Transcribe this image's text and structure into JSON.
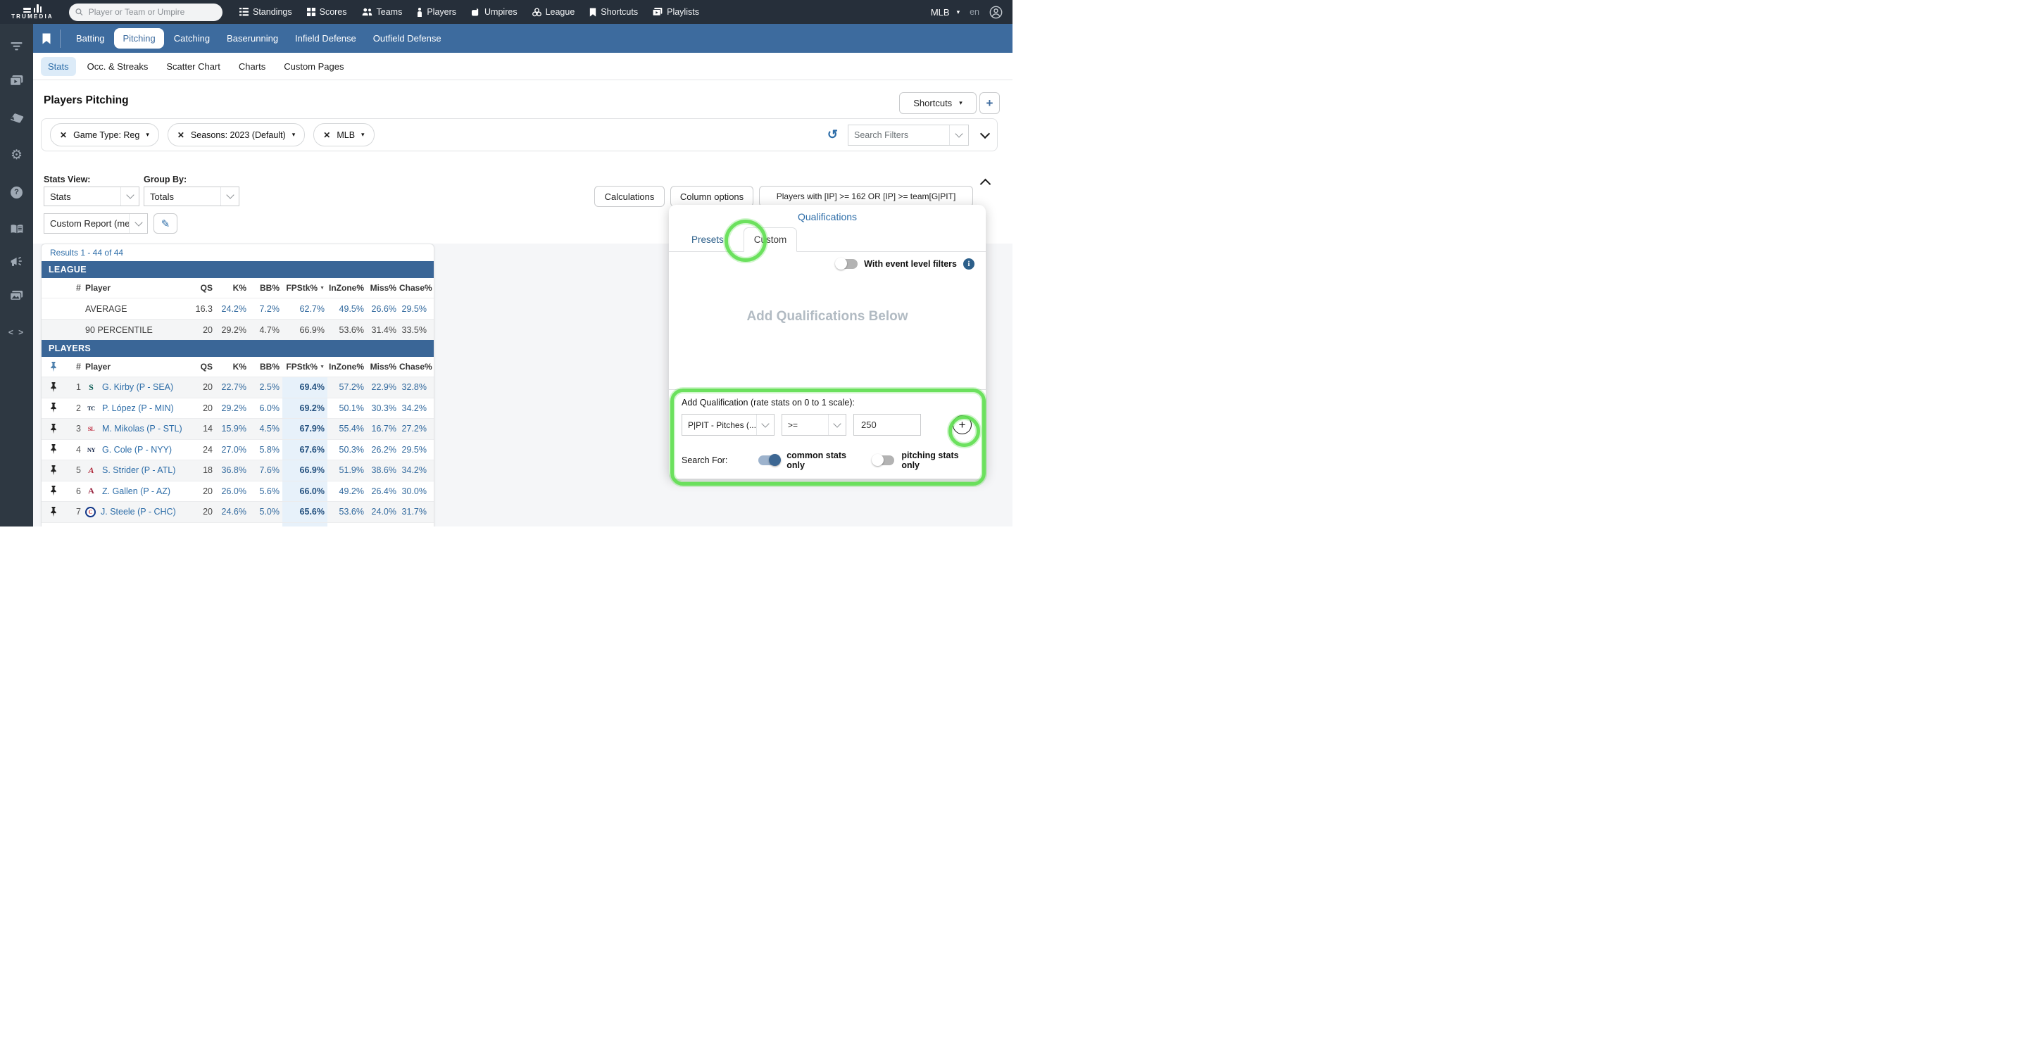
{
  "colors": {
    "topbar_bg": "#262f3a",
    "sidebar_bg": "#2e3842",
    "nav_blue": "#3d6b9e",
    "accent_blue": "#2d6da8",
    "section_header_blue": "#3a6697",
    "value_blue": "#31699e",
    "fp_band": "#e7f1fa",
    "annotation_green": "#5fde50"
  },
  "topbar": {
    "brand": "TRUMEDIA",
    "search_placeholder": "Player or Team or Umpire",
    "nav": [
      {
        "label": "Standings"
      },
      {
        "label": "Scores"
      },
      {
        "label": "Teams"
      },
      {
        "label": "Players"
      },
      {
        "label": "Umpires"
      },
      {
        "label": "League"
      },
      {
        "label": "Shortcuts"
      },
      {
        "label": "Playlists"
      }
    ],
    "league": "MLB",
    "locale": "en"
  },
  "sport_nav": {
    "tabs": [
      "Batting",
      "Pitching",
      "Catching",
      "Baserunning",
      "Infield Defense",
      "Outfield Defense"
    ],
    "active": "Pitching"
  },
  "sub_nav": {
    "tabs": [
      "Stats",
      "Occ. & Streaks",
      "Scatter Chart",
      "Charts",
      "Custom Pages"
    ],
    "active": "Stats"
  },
  "page": {
    "title": "Players Pitching",
    "shortcuts_button": "Shortcuts",
    "add_button": "+"
  },
  "filter_bar": {
    "chips": [
      {
        "label": "Game Type: Reg"
      },
      {
        "label": "Seasons: 2023 (Default)"
      },
      {
        "label": "MLB"
      }
    ],
    "search_placeholder": "Search Filters"
  },
  "controls": {
    "stats_view_label": "Stats View:",
    "stats_view_value": "Stats",
    "group_by_label": "Group By:",
    "group_by_value": "Totals",
    "report_value": "Custom Report (me)",
    "calculations": "Calculations",
    "column_options": "Column options",
    "qualifier_summary": "Players with [IP] >= 162 OR [IP] >= team[G|PIT]"
  },
  "qualifications": {
    "title": "Qualifications",
    "presets_tab": "Presets",
    "custom_tab": "Custom",
    "event_filters_label": "With event level filters",
    "empty_text": "Add Qualifications Below",
    "add_label": "Add Qualification (rate stats on 0 to 1 scale):",
    "stat_value": "P|PIT - Pitches (...",
    "operator_value": ">=",
    "threshold_value": "250",
    "search_for_label": "Search For:",
    "common_toggle_label": "common stats only",
    "pitching_toggle_label": "pitching stats only"
  },
  "table": {
    "results_summary": "Results 1 - 44 of 44",
    "league_section": "LEAGUE",
    "players_section": "PLAYERS",
    "columns": {
      "rank": "#",
      "player": "Player",
      "qs": "QS",
      "k": "K%",
      "bb": "BB%",
      "fp": "FPStk%",
      "inzone": "InZone%",
      "miss": "Miss%",
      "chase": "Chase%"
    },
    "sorted_column": "FPStk%",
    "league_rows": [
      {
        "name": "AVERAGE",
        "qs": "16.3",
        "k": "24.2%",
        "bb": "7.2%",
        "fp": "62.7%",
        "inzone": "49.5%",
        "miss": "26.6%",
        "chase": "29.5%"
      },
      {
        "name": "90 PERCENTILE",
        "qs": "20",
        "k": "29.2%",
        "bb": "4.7%",
        "fp": "66.9%",
        "inzone": "53.6%",
        "miss": "31.4%",
        "chase": "33.5%"
      }
    ],
    "player_rows": [
      {
        "rank": "1",
        "logo_text": "S",
        "logo_color": "#0a5c54",
        "player": "G. Kirby (P - SEA)",
        "qs": "20",
        "k": "22.7%",
        "bb": "2.5%",
        "fp": "69.4%",
        "inzone": "57.2%",
        "miss": "22.9%",
        "chase": "32.8%"
      },
      {
        "rank": "2",
        "logo_text": "TC",
        "logo_color": "#0c2341",
        "player": "P. López (P - MIN)",
        "qs": "20",
        "k": "29.2%",
        "bb": "6.0%",
        "fp": "69.2%",
        "inzone": "50.1%",
        "miss": "30.3%",
        "chase": "34.2%"
      },
      {
        "rank": "3",
        "logo_text": "SL",
        "logo_color": "#bd2236",
        "player": "M. Mikolas (P - STL)",
        "qs": "14",
        "k": "15.9%",
        "bb": "4.5%",
        "fp": "67.9%",
        "inzone": "55.4%",
        "miss": "16.7%",
        "chase": "27.2%"
      },
      {
        "rank": "4",
        "logo_text": "NY",
        "logo_color": "#132448",
        "player": "G. Cole (P - NYY)",
        "qs": "24",
        "k": "27.0%",
        "bb": "5.8%",
        "fp": "67.6%",
        "inzone": "50.3%",
        "miss": "26.2%",
        "chase": "29.5%"
      },
      {
        "rank": "5",
        "logo_text": "A",
        "logo_color": "#b0293a",
        "player": "S. Strider (P - ATL)",
        "qs": "18",
        "k": "36.8%",
        "bb": "7.6%",
        "fp": "66.9%",
        "inzone": "51.9%",
        "miss": "38.6%",
        "chase": "34.2%"
      },
      {
        "rank": "6",
        "logo_text": "A",
        "logo_color": "#97233f",
        "player": "Z. Gallen (P - AZ)",
        "qs": "20",
        "k": "26.0%",
        "bb": "5.6%",
        "fp": "66.0%",
        "inzone": "49.2%",
        "miss": "26.4%",
        "chase": "30.0%"
      },
      {
        "rank": "7",
        "logo_text": "C",
        "logo_color": "#cc3433",
        "player": "J. Steele (P - CHC)",
        "qs": "20",
        "k": "24.6%",
        "bb": "5.0%",
        "fp": "65.6%",
        "inzone": "53.6%",
        "miss": "24.0%",
        "chase": "31.7%"
      }
    ]
  }
}
